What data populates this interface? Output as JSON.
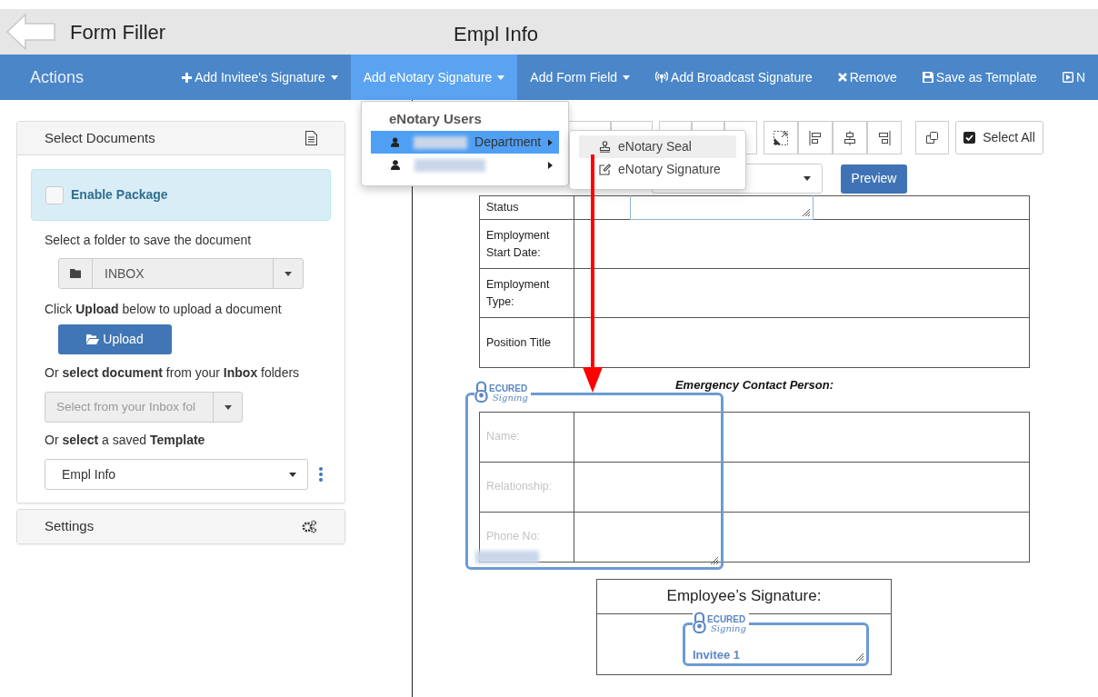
{
  "header": {
    "title": "Form Filler",
    "document_title": "Empl Info"
  },
  "actions_bar": {
    "title": "Actions",
    "items": [
      {
        "label": "Add Invitee's Signature",
        "dropdown": true,
        "selected": false
      },
      {
        "label": "Add eNotary Signature",
        "dropdown": true,
        "selected": true
      },
      {
        "label": "Add Form Field",
        "dropdown": true,
        "selected": false
      },
      {
        "label": "Add Broadcast Signature",
        "dropdown": false,
        "selected": false
      },
      {
        "label": "Remove",
        "dropdown": false,
        "selected": false
      },
      {
        "label": "Save as Template",
        "dropdown": false,
        "selected": false
      },
      {
        "label": "N",
        "dropdown": false,
        "selected": false
      }
    ]
  },
  "enotary_menu": {
    "heading": "eNotary Users",
    "users": [
      {
        "label": "Department",
        "selected": true
      },
      {
        "selected": false
      }
    ],
    "submenu": [
      {
        "label": "eNotary Seal",
        "selected": true
      },
      {
        "label": "eNotary Signature",
        "selected": false
      }
    ]
  },
  "select_documents": {
    "title": "Select Documents",
    "enable_package": {
      "label": "Enable Package",
      "checked": false
    },
    "folder_label": "Select a folder to save the document",
    "folder": "INBOX",
    "upload_hint": "Click **Upload** below to upload a document",
    "upload_button": "Upload",
    "inbox_hint": "Or **select document** from your **Inbox** folders",
    "inbox_placeholder": "Select from your Inbox fol",
    "template_hint": "Or **select** a saved **Template**",
    "template": "Empl Info"
  },
  "settings": {
    "title": "Settings"
  },
  "toolbar": {
    "select_all": "Select All",
    "preview": "Preview"
  },
  "document": {
    "rows": [
      "Status",
      "Employment Start Date:",
      "Employment Type:",
      "Position Title"
    ],
    "emergency_heading": "Emergency Contact Person:",
    "emergency_rows": [
      "Name:",
      "Relationship:",
      "Phone No:"
    ],
    "signature_heading": "Employee’s Signature:"
  },
  "fields": [
    {
      "logo_top": "ECURED",
      "logo_script": "Signing"
    },
    {
      "logo_top": "ECURED",
      "logo_script": "Signing",
      "label": "Invitee 1"
    }
  ]
}
